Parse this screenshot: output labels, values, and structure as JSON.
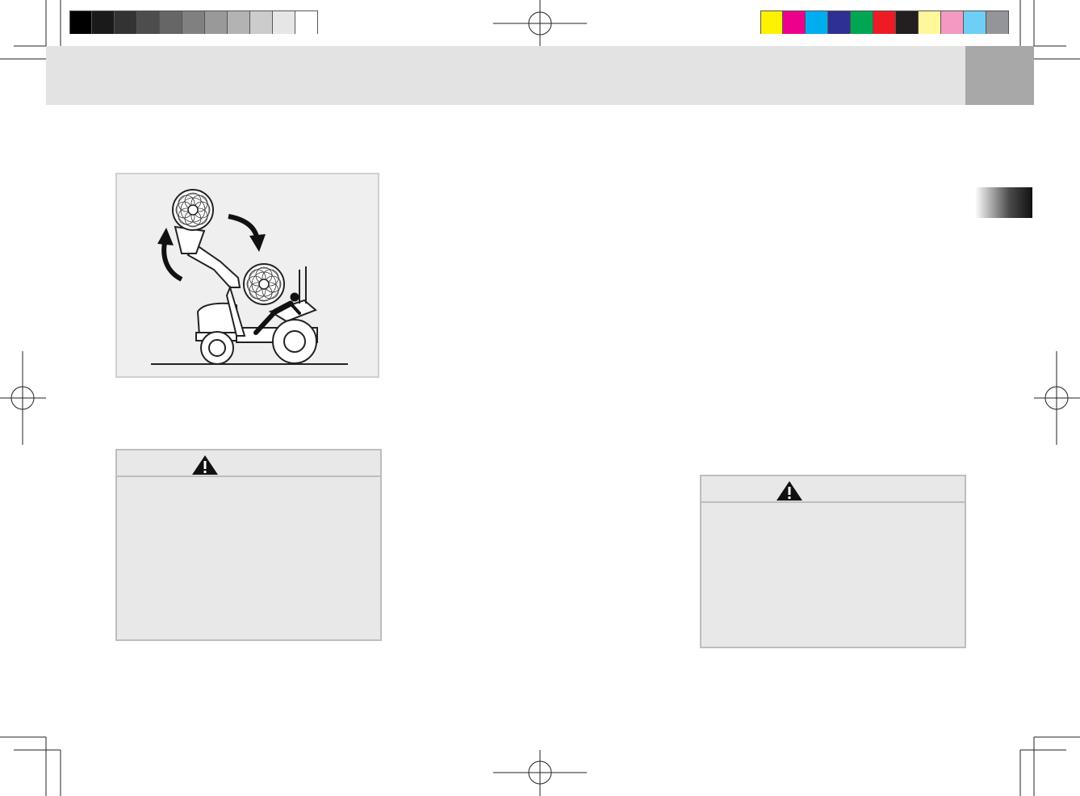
{
  "print_marks": {
    "gray_scale": [
      "#000000",
      "#1a1a1a",
      "#333333",
      "#4d4d4d",
      "#666666",
      "#808080",
      "#999999",
      "#b3b3b3",
      "#cccccc",
      "#e6e6e6",
      "#ffffff"
    ],
    "color_bar": [
      "#fff200",
      "#ec008c",
      "#00aeef",
      "#2e3192",
      "#00a651",
      "#ed1c24",
      "#231f20",
      "#fff799",
      "#f49ac1",
      "#6dcff6",
      "#939598"
    ]
  },
  "header": {
    "band_color": "#e3e3e3",
    "tab_color": "#a8a8a8"
  },
  "figure": {
    "icon": "tractor-loader-rollover-illustration"
  },
  "warnings": [
    {
      "icon": "warning-triangle-icon"
    },
    {
      "icon": "warning-triangle-icon"
    }
  ]
}
